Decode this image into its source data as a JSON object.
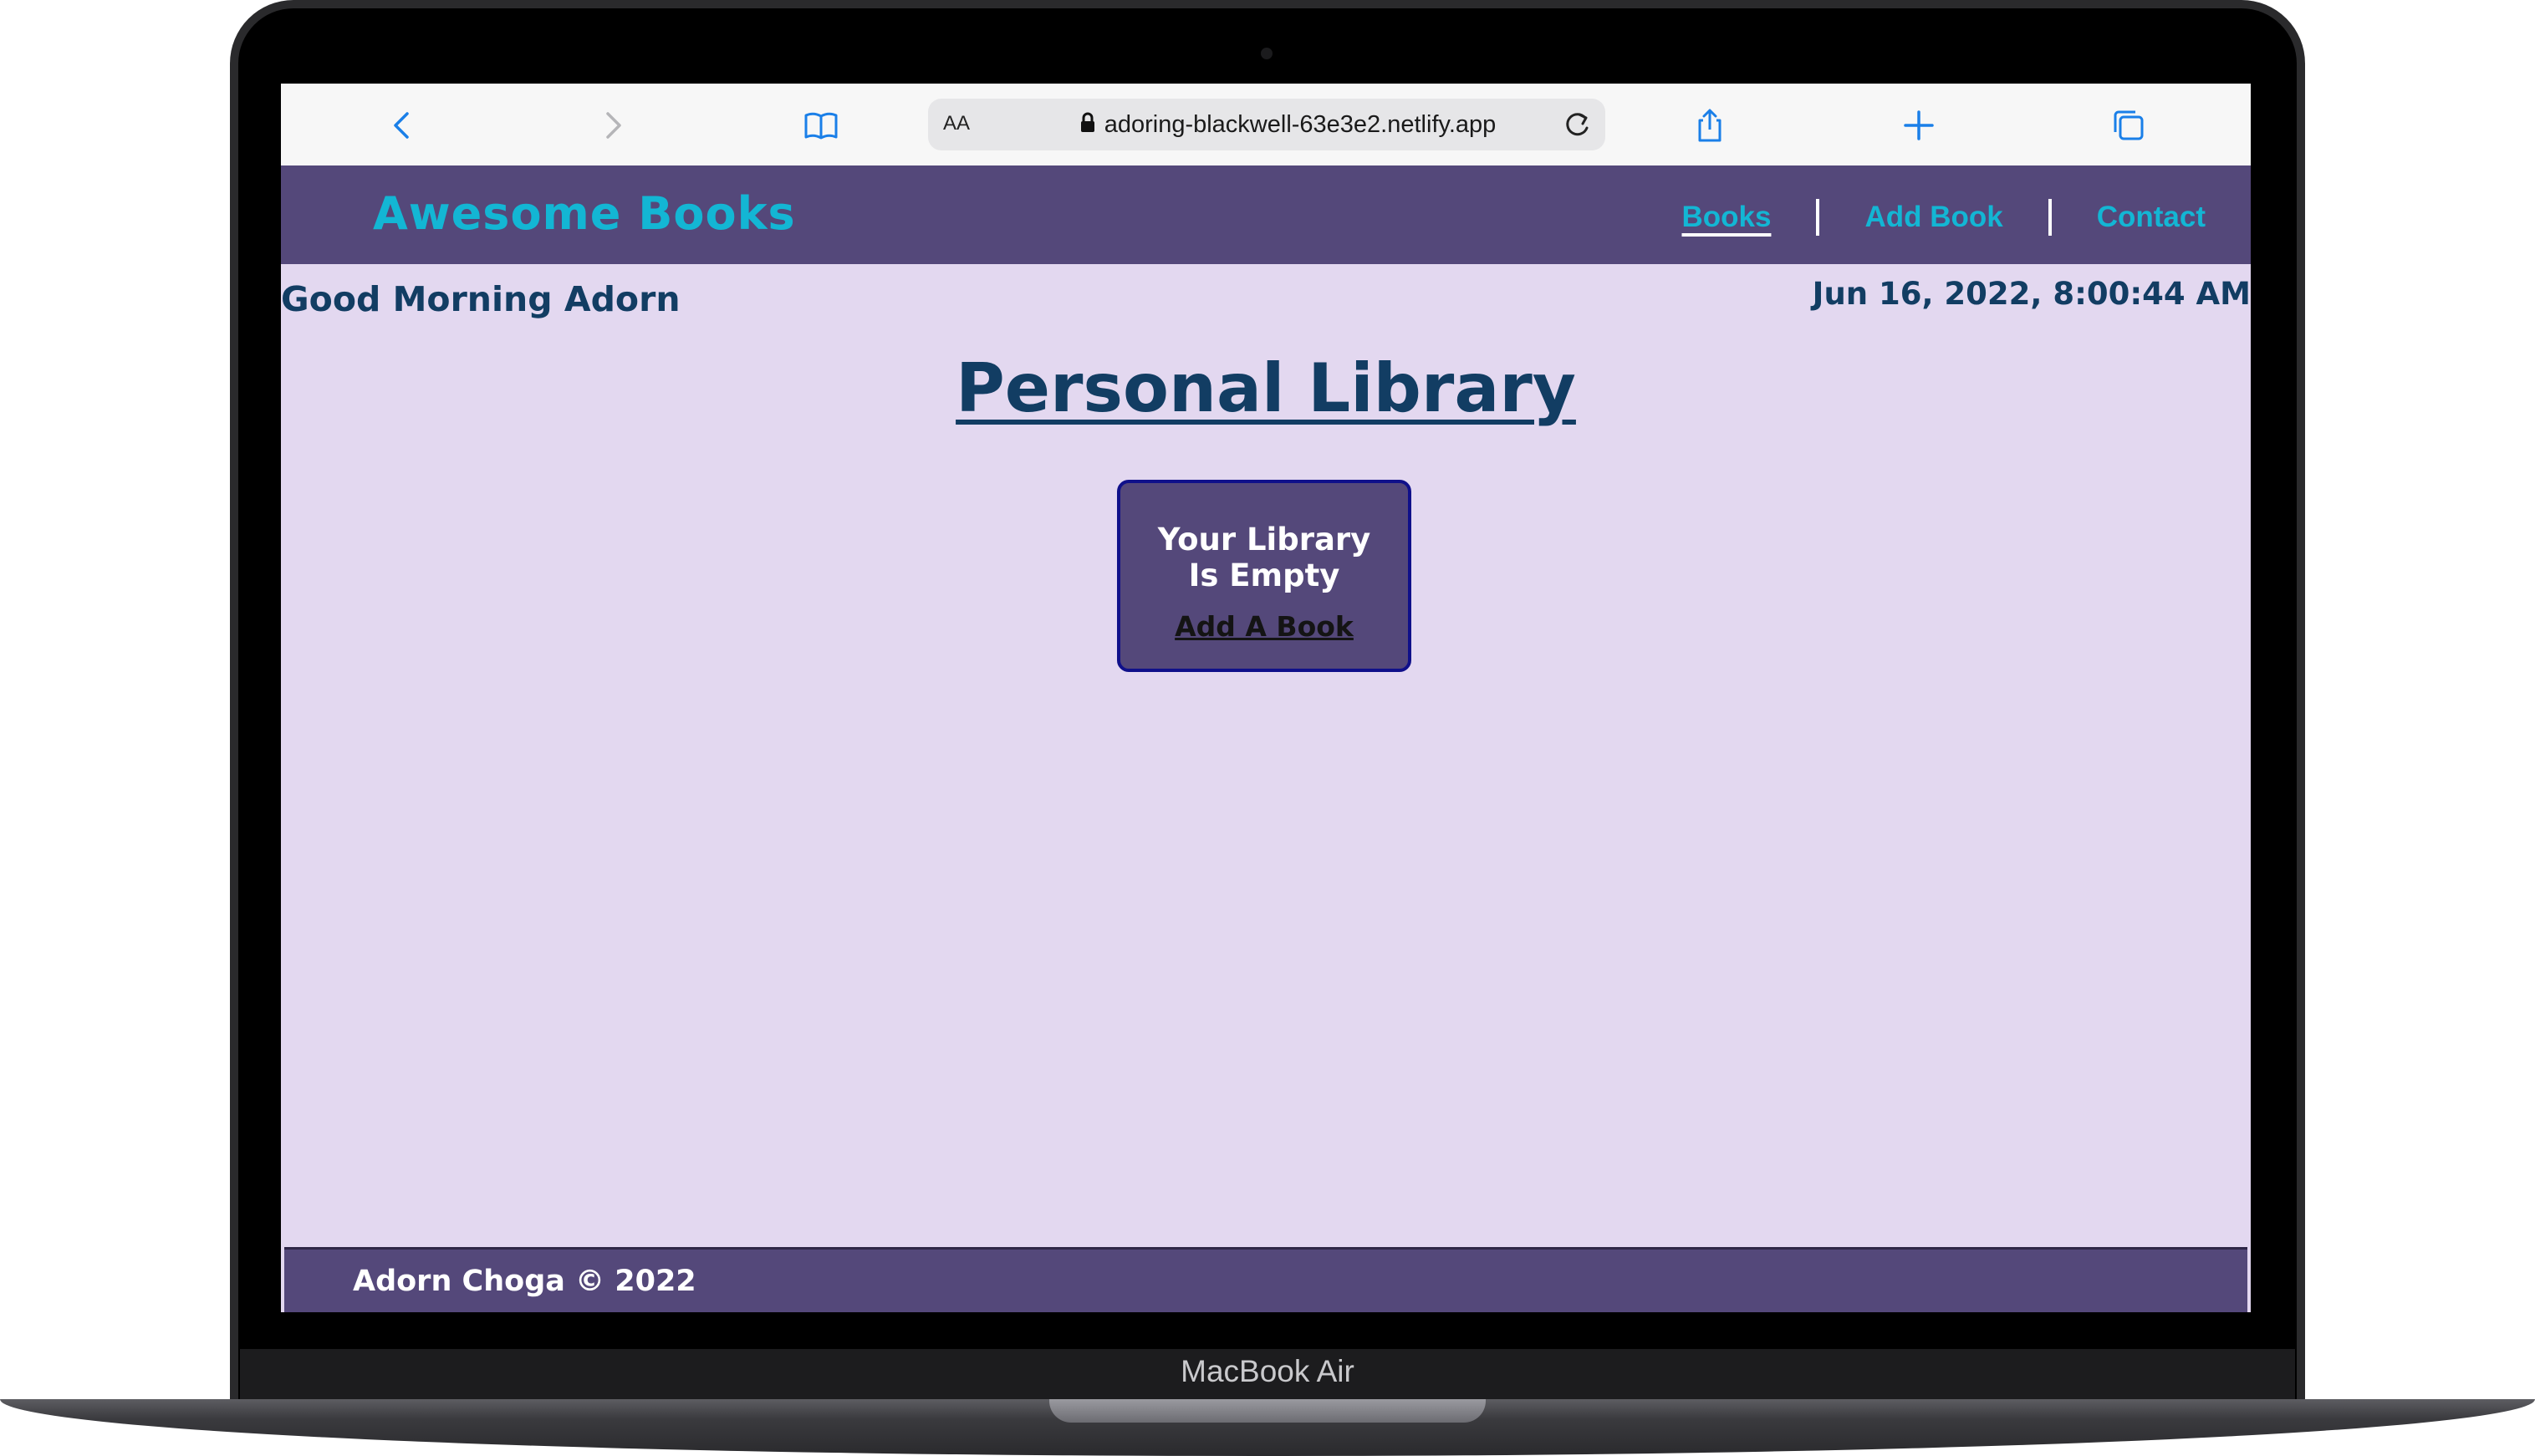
{
  "device": {
    "label": "MacBook Air"
  },
  "browser": {
    "text_size_label": "AA",
    "url": "adoring-blackwell-63e3e2.netlify.app",
    "icons": [
      "back-icon",
      "forward-icon",
      "bookmarks-icon",
      "lock-icon",
      "reload-icon",
      "share-icon",
      "new-tab-icon",
      "tabs-icon"
    ]
  },
  "header": {
    "brand": "Awesome Books",
    "nav": [
      {
        "label": "Books",
        "active": true
      },
      {
        "label": "Add Book",
        "active": false
      },
      {
        "label": "Contact",
        "active": false
      }
    ]
  },
  "main": {
    "greeting": "Good Morning Adorn",
    "datetime": "Jun 16, 2022, 8:00:44 AM",
    "title": "Personal Library",
    "empty_state": {
      "line1": "Your Library",
      "line2": "Is Empty",
      "link": "Add A Book"
    }
  },
  "footer": {
    "text": "Adorn Choga © 2022"
  },
  "colors": {
    "header_bg": "#54487a",
    "page_bg": "#e3d8f0",
    "brand": "#13b6d4",
    "heading": "#123d63"
  }
}
